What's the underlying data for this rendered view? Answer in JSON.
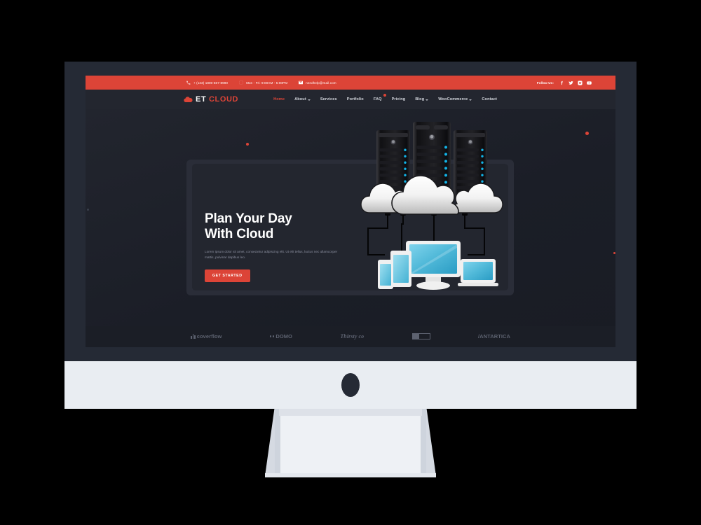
{
  "device": {
    "kind": "desktop-monitor",
    "chin_color": "#e9edf2",
    "bezel_color": "#252a35"
  },
  "site": {
    "topbar": {
      "phone": "+ (123) 1800-567-8990",
      "hours": "Mon - Fri: 9:00AM - 5:00PM",
      "email": "needhelp@mail.com",
      "follow_label": "Follow Us:",
      "socials": [
        {
          "name": "facebook-icon",
          "glyph": "f"
        },
        {
          "name": "twitter-icon",
          "glyph": "t"
        },
        {
          "name": "instagram-icon",
          "glyph": "i"
        },
        {
          "name": "youtube-icon",
          "glyph": "y"
        }
      ],
      "background": "#dc4437"
    },
    "header": {
      "logo_icon": "cloud-icon",
      "logo_primary": "ET",
      "logo_secondary": "CLOUD",
      "nav": [
        {
          "label": "Home",
          "active": true,
          "caret": false,
          "badge": false
        },
        {
          "label": "About",
          "active": false,
          "caret": true,
          "badge": false
        },
        {
          "label": "Services",
          "active": false,
          "caret": false,
          "badge": false
        },
        {
          "label": "Portfolio",
          "active": false,
          "caret": false,
          "badge": false
        },
        {
          "label": "FAQ",
          "active": false,
          "caret": false,
          "badge": true
        },
        {
          "label": "Pricing",
          "active": false,
          "caret": false,
          "badge": false
        },
        {
          "label": "Blog",
          "active": false,
          "caret": true,
          "badge": false
        },
        {
          "label": "WooCommerce",
          "active": false,
          "caret": true,
          "badge": false
        },
        {
          "label": "Contact",
          "active": false,
          "caret": false,
          "badge": false
        }
      ]
    },
    "hero": {
      "title": "Plan Your Day\nWith Cloud",
      "subtitle": "Lorem ipsum dolor sit amet, consectetur adipiscing elit. Ut elit tellus, luctus nec ullamcorper mattis, pulvinar dapibus leo.",
      "cta_label": "GET STARTED",
      "accent_color": "#dc4437",
      "illustration": "cloud-server-devices-diagram"
    },
    "partners": [
      {
        "name": "coverflow",
        "label": "coverflow",
        "style": "bars"
      },
      {
        "name": "domo",
        "label": "DOMO",
        "style": "dots"
      },
      {
        "name": "thirsty-co",
        "label": "Thirsty co",
        "style": "italic"
      },
      {
        "name": "boxed-brand",
        "label": "",
        "style": "box"
      },
      {
        "name": "antartica",
        "label": "/ANTARTICA",
        "style": "plain"
      }
    ]
  }
}
